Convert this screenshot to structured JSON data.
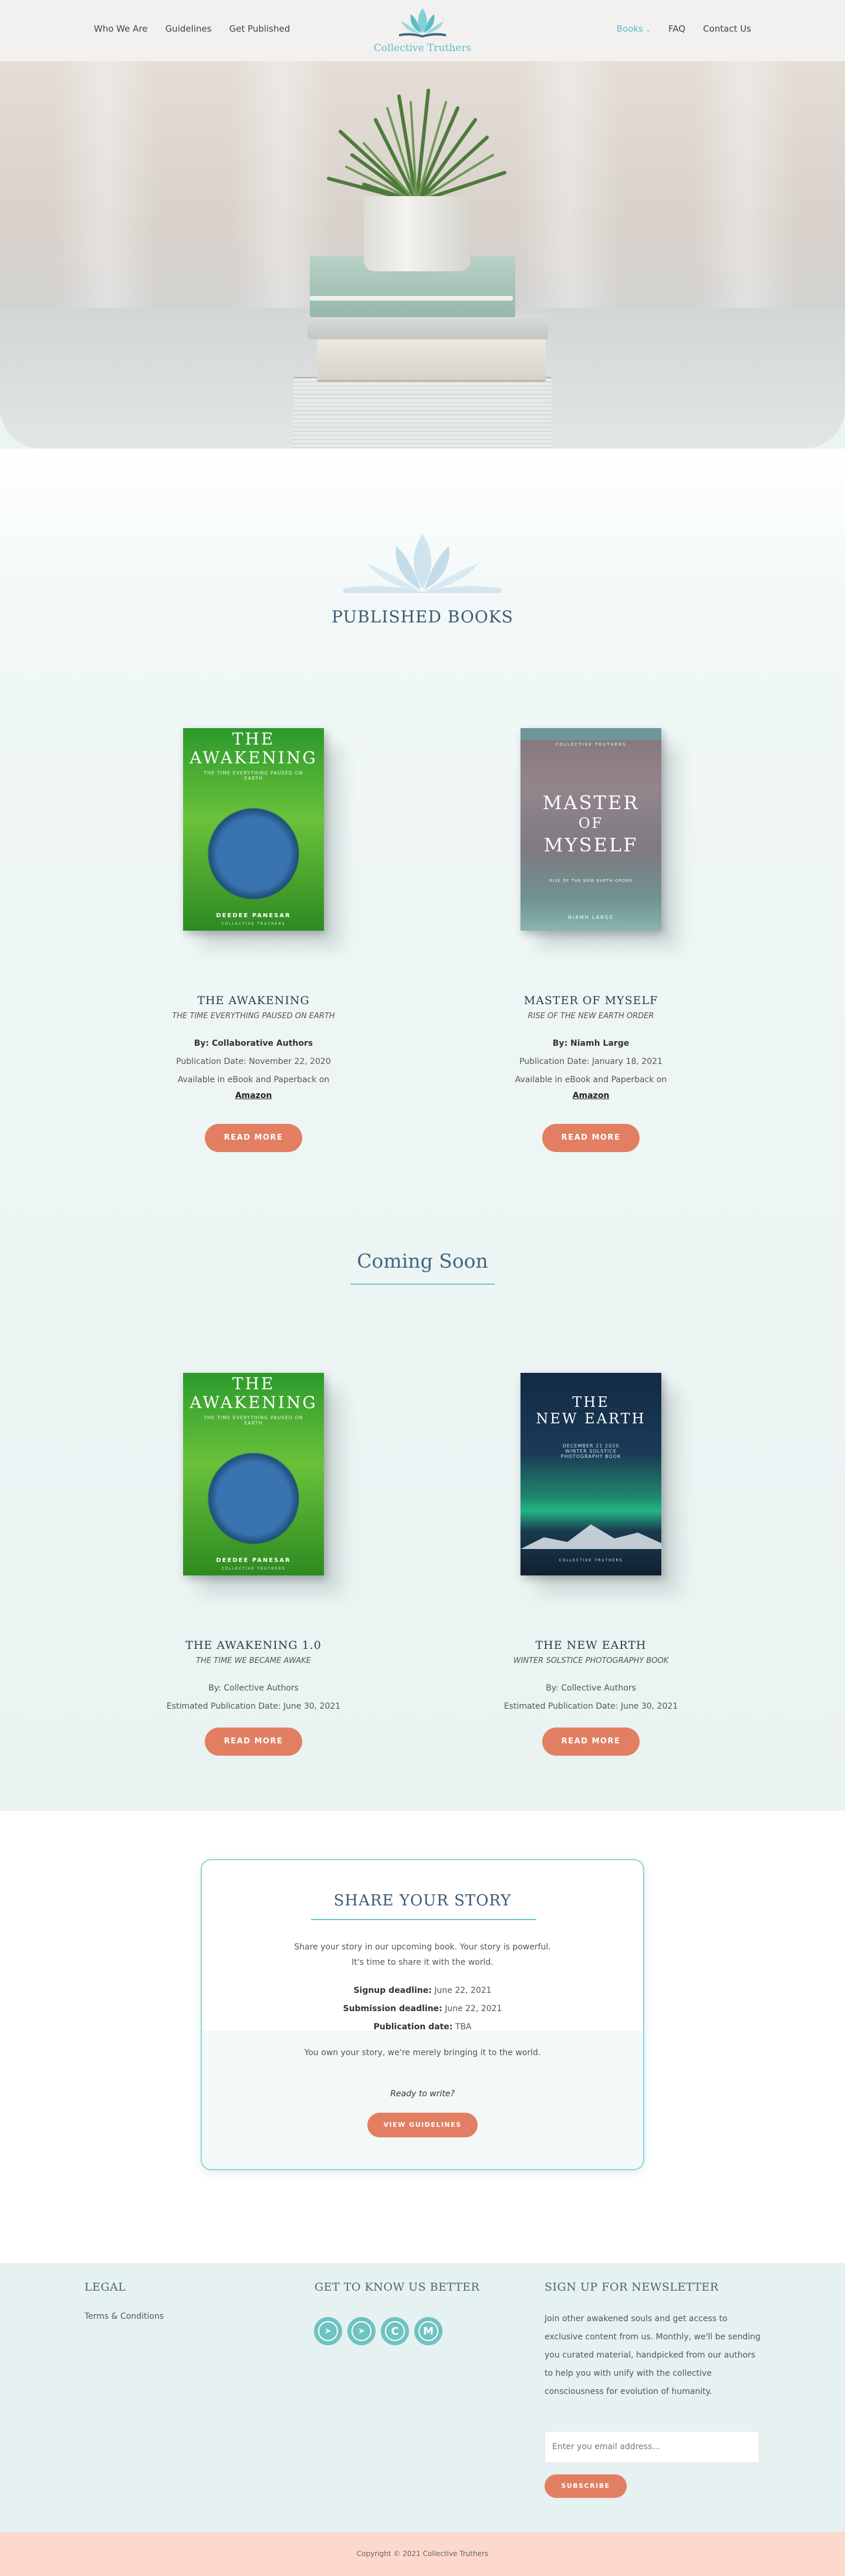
{
  "header": {
    "nav_left": [
      "Who We Are",
      "Guidelines",
      "Get Published"
    ],
    "logo_text": "Collective Truthers",
    "nav_right": [
      {
        "label": "Books",
        "active": true
      },
      {
        "label": "FAQ",
        "active": false
      },
      {
        "label": "Contact Us",
        "active": false
      }
    ]
  },
  "published": {
    "title": "PUBLISHED BOOKS",
    "books": [
      {
        "cover_title": [
          "THE",
          "AWAKENING"
        ],
        "cover_sub": "THE TIME EVERYTHING PAUSED ON EARTH",
        "cover_author": "DEEDEE PANESAR",
        "cover_publisher": "COLLECTIVE TRUTHERS",
        "title": "THE AWAKENING",
        "subtitle": "THE TIME EVERYTHING PAUSED ON EARTH",
        "author_label": "By: Collaborative Authors",
        "date": "Publication Date: November 22, 2020",
        "availability": "Available in eBook and Paperback on",
        "store": "Amazon",
        "button": "READ MORE"
      },
      {
        "cover_top": "COLLECTIVE TRUTHERS",
        "cover_title": [
          "MASTER",
          "OF",
          "MYSELF"
        ],
        "cover_sub": "RISE OF THE NEW EARTH ORDER",
        "cover_author": "NIAMH LARGE",
        "title": "MASTER OF MYSELF",
        "subtitle": "RISE OF THE NEW EARTH ORDER",
        "author_label": "By: Niamh Large",
        "date": "Publication Date: January 18, 2021",
        "availability": "Available in eBook and Paperback on",
        "store": "Amazon",
        "button": "READ MORE"
      }
    ]
  },
  "coming_soon": {
    "title": "Coming Soon",
    "books": [
      {
        "cover_title": [
          "THE",
          "AWAKENING"
        ],
        "cover_sub": "THE TIME EVERYTHING PAUSED ON EARTH",
        "cover_author": "DEEDEE PANESAR",
        "cover_publisher": "COLLECTIVE TRUTHERS",
        "title": "THE AWAKENING 1.0",
        "subtitle": "THE TIME WE BECAME AWAKE",
        "author_label": "By: Collective Authors",
        "date": "Estimated Publication Date: June 30, 2021",
        "button": "READ MORE"
      },
      {
        "cover_title": [
          "THE",
          "NEW EARTH"
        ],
        "cover_sub": "DECEMBER 21 2020 WINTER SOLSTICE PHOTOGRAPHY BOOK",
        "cover_publisher": "COLLECTIVE TRUTHERS",
        "title": "THE NEW EARTH",
        "subtitle": "WINTER SOLSTICE PHOTOGRAPHY BOOK",
        "author_label": "By: Collective Authors",
        "date": "Estimated Publication Date: June 30, 2021",
        "button": "READ MORE"
      }
    ]
  },
  "share": {
    "title": "SHARE YOUR STORY",
    "line1": "Share your story in our upcoming book. Your story is powerful.",
    "line2": "It's time to share it with the world.",
    "signup_label": "Signup deadline:",
    "signup_value": " June 22, 2021",
    "submission_label": "Submission deadline:",
    "submission_value": " June 22, 2021",
    "publication_label": "Publication date:",
    "publication_value": " TBA",
    "own_story": "You own your story, we're merely bringing it to the world.",
    "ready": "Ready to write?",
    "button": "VIEW GUIDELINES"
  },
  "footer": {
    "legal_title": "LEGAL",
    "terms": "Terms & Conditions",
    "know_title": "GET TO KNOW US BETTER",
    "social": [
      {
        "name": "telegram",
        "glyph": "➤"
      },
      {
        "name": "telegram-alt",
        "glyph": "➤"
      },
      {
        "name": "creative",
        "glyph": "C"
      },
      {
        "name": "medium",
        "glyph": "M"
      }
    ],
    "newsletter_title": "SIGN UP FOR NEWSLETTER",
    "newsletter_text": "Join other awakened souls and get access to exclusive content from us. Monthly, we'll be sending you curated material, handpicked from our authors to help you with unify with the collective consciousness for evolution of humanity.",
    "email_placeholder": "Enter you email address...",
    "subscribe": "SUBSCRIBE",
    "copyright": "Copyright © 2021 Collective Truthers"
  },
  "colors": {
    "accent": "#5cbdc6",
    "button": "#e27f62",
    "heading": "#3e5a73",
    "copyright_bg": "#fcd9cc"
  }
}
